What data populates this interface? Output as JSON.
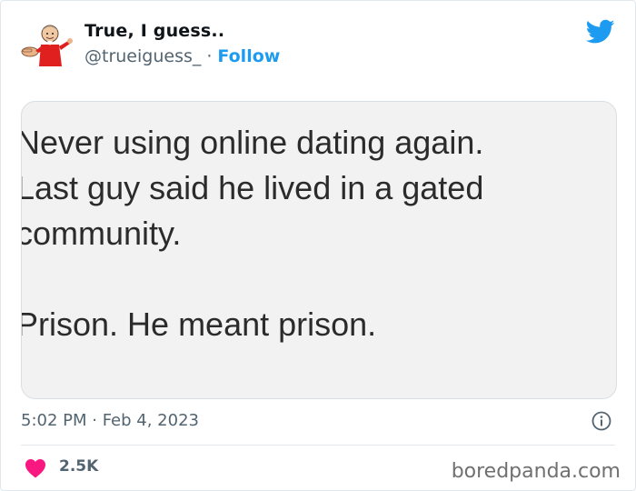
{
  "author": {
    "display_name": "True, I guess..",
    "handle": "@trueiguess_",
    "separator": "·",
    "follow_label": "Follow",
    "avatar_icon": "cartoon-man-pointing-avatar"
  },
  "brand_icon": "twitter-bird-icon",
  "tweet_image": {
    "lines": [
      "Never using online dating again.",
      "Last guy said he lived in a gated",
      "community.",
      "Prison. He meant prison."
    ]
  },
  "meta": {
    "timestamp": "5:02 PM · Feb 4, 2023"
  },
  "engagement": {
    "likes": "2.5K"
  },
  "watermark": "boredpanda.com",
  "colors": {
    "accent": "#1d9bf0",
    "heart": "#f91880",
    "muted": "#536471"
  }
}
